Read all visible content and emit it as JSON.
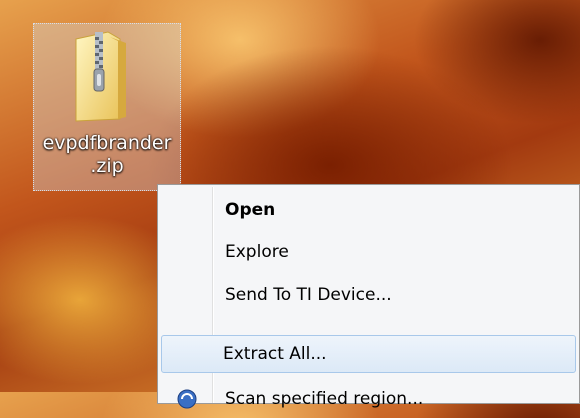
{
  "desktop": {
    "file_icon": {
      "name_line1": "evpdfbrander",
      "name_line2": ".zip",
      "icon": "zip-folder-icon"
    }
  },
  "context_menu": {
    "items": [
      {
        "label": "Open",
        "bold": true
      },
      {
        "label": "Explore"
      },
      {
        "label": "Send To TI Device..."
      },
      {
        "label": "Extract All...",
        "highlighted": true
      },
      {
        "label": "Scan specified region..."
      }
    ]
  }
}
